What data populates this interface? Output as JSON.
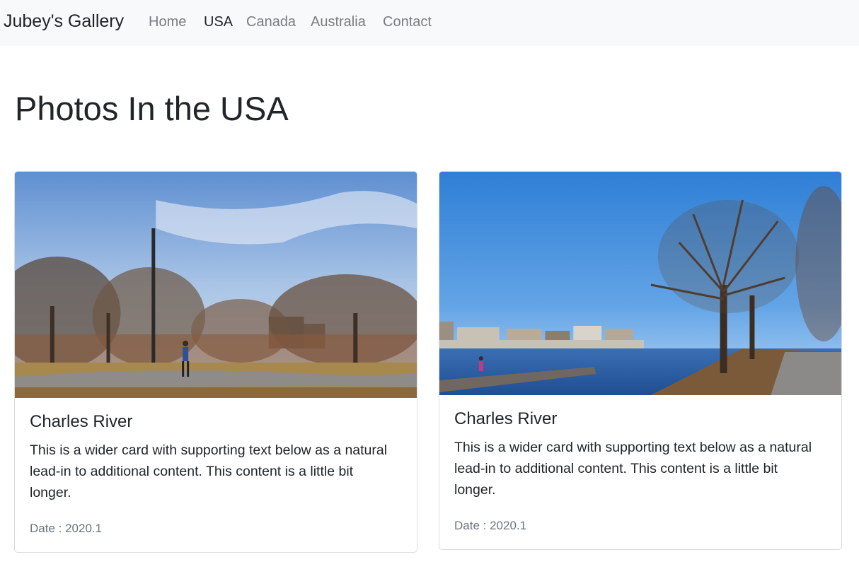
{
  "nav": {
    "brand": "Jubey's Gallery",
    "links": [
      {
        "label": "Home",
        "active": false
      },
      {
        "label": "USA",
        "active": true
      },
      {
        "label": "Canada",
        "active": false
      },
      {
        "label": "Australia",
        "active": false
      },
      {
        "label": "Contact",
        "active": false
      }
    ]
  },
  "page": {
    "title": "Photos In the USA"
  },
  "cards": [
    {
      "title": "Charles River",
      "text": "This is a wider card with supporting text below as a natural lead-in to additional content. This content is a little bit longer.",
      "date": "Date : 2020.1",
      "image_icon": "park-photo"
    },
    {
      "title": "Charles River",
      "text": "This is a wider card with supporting text below as a natural lead-in to additional content. This content is a little bit longer.",
      "date": "Date : 2020.1",
      "image_icon": "river-bridge-photo"
    }
  ],
  "colors": {
    "navbar_bg": "#f8f9fa",
    "nav_inactive": "#7a7d80",
    "nav_active": "#212529",
    "muted_text": "#6c757d"
  }
}
